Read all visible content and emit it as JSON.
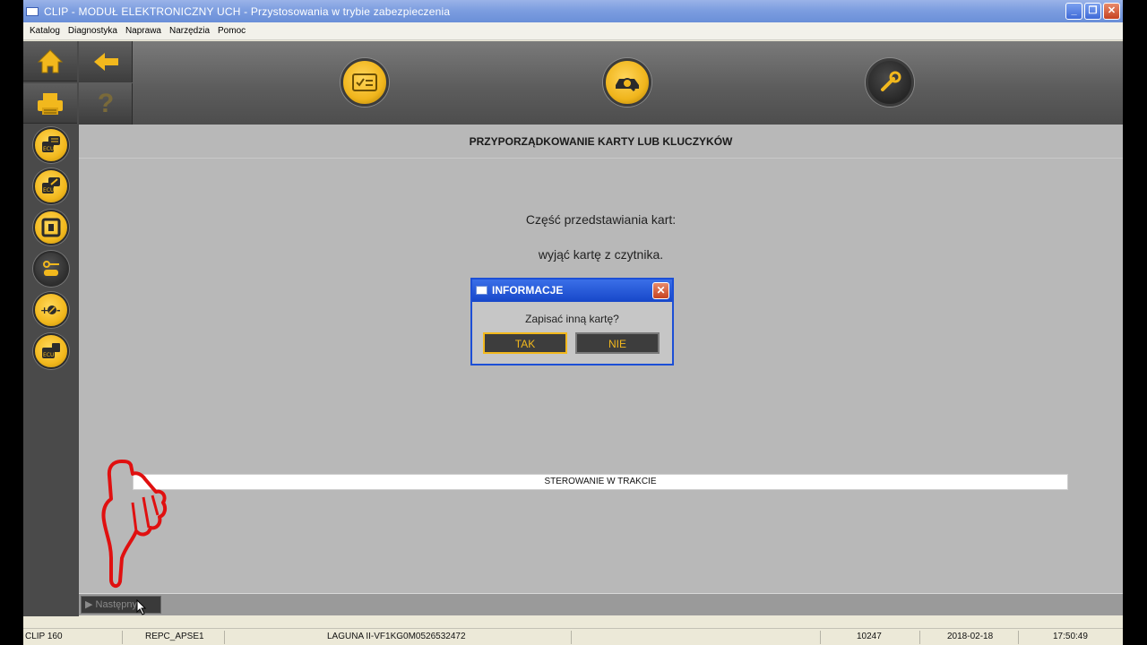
{
  "window": {
    "title": "CLIP - MODUŁ ELEKTRONICZNY UCH - Przystosowania w trybie zabezpieczenia",
    "minimize": "_",
    "restore": "❐",
    "close": "✕"
  },
  "menu": [
    "Katalog",
    "Diagnostyka",
    "Naprawa",
    "Narzędzia",
    "Pomoc"
  ],
  "nav": {
    "home_icon": "home-icon",
    "back_icon": "back-arrow-icon",
    "print_icon": "printer-icon",
    "help_label": "?"
  },
  "toolbar_icons": [
    "checklist-card-icon",
    "vehicle-diagnostic-icon",
    "wrench-icon"
  ],
  "side_icons": [
    "ecu-info-icon",
    "ecu-edit-icon",
    "component-icon",
    "key-vehicle-icon",
    "plus-minus-icon",
    "ecu-config-icon"
  ],
  "content": {
    "heading": "PRZYPORZĄDKOWANIE KARTY LUB KLUCZYKÓW",
    "line1": "Część przedstawiania kart:",
    "line2": "wyjąć kartę z czytnika.",
    "progress_text": "STEROWANIE W TRAKCIE"
  },
  "dialog": {
    "title": "INFORMACJE",
    "question": "Zapisać inną kartę?",
    "yes_label": "TAK",
    "no_label": "NIE",
    "close": "✕"
  },
  "bottom": {
    "next_label": "▶ Następny"
  },
  "status": {
    "version": "CLIP 160",
    "code": "REPC_APSE1",
    "vehicle": "LAGUNA II-VF1KG0M0526532472",
    "number": "10247",
    "date": "2018-02-18",
    "time": "17:50:49"
  },
  "colors": {
    "accent": "#f2b81d",
    "titlebar": "#6a8fd8",
    "content_bg": "#b8b8b8"
  }
}
